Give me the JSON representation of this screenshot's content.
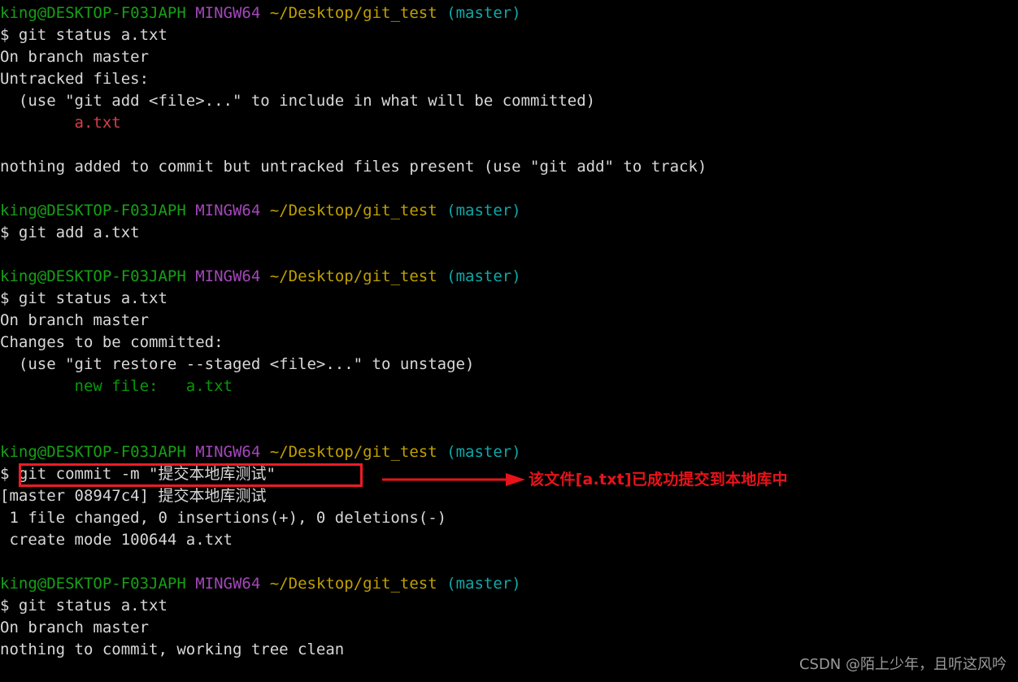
{
  "terminal": {
    "shell": "MINGW64",
    "user_host": "king@DESKTOP-F03JAPH",
    "path": "~/Desktop/git_test",
    "branch": "(master)",
    "prompt_symbol": "$",
    "colors": {
      "background": "#000000",
      "foreground": "#d8d8d8",
      "user_host": "#16a016",
      "shell": "#a347ba",
      "path": "#c0a000",
      "branch": "#0fa8a8",
      "untracked_file": "#d6404c",
      "staged_file": "#089808",
      "annotation": "#e8131a"
    }
  },
  "blocks": [
    {
      "command": "git status a.txt",
      "output": [
        "On branch master",
        "Untracked files:",
        "  (use \"git add <file>...\" to include in what will be committed)",
        "        a.txt",
        "",
        "nothing added to commit but untracked files present (use \"git add\" to track)",
        ""
      ]
    },
    {
      "command": "git add a.txt",
      "output": [
        ""
      ]
    },
    {
      "command": "git status a.txt",
      "output": [
        "On branch master",
        "Changes to be committed:",
        "  (use \"git restore --staged <file>...\" to unstage)",
        "        new file:   a.txt",
        "",
        ""
      ]
    },
    {
      "command": "git commit -m \"提交本地库测试\"",
      "output": [
        "[master 08947c4] 提交本地库测试",
        " 1 file changed, 0 insertions(+), 0 deletions(-)",
        " create mode 100644 a.txt",
        ""
      ]
    },
    {
      "command": "git status a.txt",
      "output": [
        "On branch master",
        "nothing to commit, working tree clean"
      ]
    }
  ],
  "lines": [
    {
      "kind": "prompt"
    },
    {
      "kind": "command",
      "text": "git status a.txt"
    },
    {
      "kind": "out",
      "text": "On branch master"
    },
    {
      "kind": "out",
      "text": "Untracked files:"
    },
    {
      "kind": "out",
      "text": "  (use \"git add <file>...\" to include in what will be committed)"
    },
    {
      "kind": "out-untracked",
      "indent": "        ",
      "text": "a.txt"
    },
    {
      "kind": "blank"
    },
    {
      "kind": "out",
      "text": "nothing added to commit but untracked files present (use \"git add\" to track)"
    },
    {
      "kind": "blank"
    },
    {
      "kind": "prompt"
    },
    {
      "kind": "command",
      "text": "git add a.txt"
    },
    {
      "kind": "blank"
    },
    {
      "kind": "prompt"
    },
    {
      "kind": "command",
      "text": "git status a.txt"
    },
    {
      "kind": "out",
      "text": "On branch master"
    },
    {
      "kind": "out",
      "text": "Changes to be committed:"
    },
    {
      "kind": "out",
      "text": "  (use \"git restore --staged <file>...\" to unstage)"
    },
    {
      "kind": "out-staged",
      "indent": "        ",
      "text": "new file:   a.txt"
    },
    {
      "kind": "blank"
    },
    {
      "kind": "blank"
    },
    {
      "kind": "prompt"
    },
    {
      "kind": "command-boxed",
      "text": "git commit -m \"提交本地库测试\""
    },
    {
      "kind": "out-cjk",
      "text": "[master 08947c4] 提交本地库测试"
    },
    {
      "kind": "out",
      "text": " 1 file changed, 0 insertions(+), 0 deletions(-)"
    },
    {
      "kind": "out",
      "text": " create mode 100644 a.txt"
    },
    {
      "kind": "blank"
    },
    {
      "kind": "prompt"
    },
    {
      "kind": "command",
      "text": "git status a.txt"
    },
    {
      "kind": "out",
      "text": "On branch master"
    },
    {
      "kind": "out",
      "text": "nothing to commit, working tree clean"
    }
  ],
  "annotation": {
    "text": "该文件[a.txt]已成功提交到本地库中",
    "arrow_direction": "right"
  },
  "watermark": {
    "text": "CSDN @陌上少年，且听这风吟"
  }
}
